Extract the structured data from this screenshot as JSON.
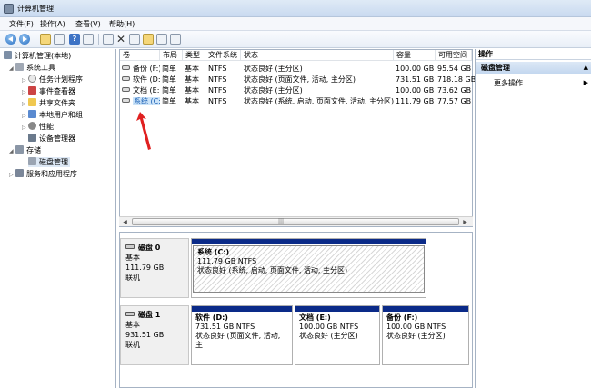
{
  "window": {
    "title": "计算机管理"
  },
  "menu": [
    "文件(F)",
    "操作(A)",
    "查看(V)",
    "帮助(H)"
  ],
  "tree": {
    "root": "计算机管理(本地)",
    "system_tools": "系统工具",
    "task_scheduler": "任务计划程序",
    "event_viewer": "事件查看器",
    "shared_folders": "共享文件夹",
    "local_users": "本地用户和组",
    "performance": "性能",
    "device_manager": "设备管理器",
    "storage": "存储",
    "disk_management": "磁盘管理",
    "services_apps": "服务和应用程序"
  },
  "columns": [
    "卷",
    "布局",
    "类型",
    "文件系统",
    "状态",
    "容量",
    "可用空间"
  ],
  "volumes": [
    {
      "name": "备份 (F:)",
      "layout": "简单",
      "type": "基本",
      "fs": "NTFS",
      "status": "状态良好 (主分区)",
      "capacity": "100.00 GB",
      "free": "95.54 GB"
    },
    {
      "name": "软件 (D:)",
      "layout": "简单",
      "type": "基本",
      "fs": "NTFS",
      "status": "状态良好 (页面文件, 活动, 主分区)",
      "capacity": "731.51 GB",
      "free": "718.18 GB"
    },
    {
      "name": "文档 (E:)",
      "layout": "简单",
      "type": "基本",
      "fs": "NTFS",
      "status": "状态良好 (主分区)",
      "capacity": "100.00 GB",
      "free": "73.62 GB"
    },
    {
      "name": "系统 (C:)",
      "layout": "简单",
      "type": "基本",
      "fs": "NTFS",
      "status": "状态良好 (系统, 启动, 页面文件, 活动, 主分区)",
      "capacity": "111.79 GB",
      "free": "77.57 GB"
    }
  ],
  "disks": [
    {
      "title": "磁盘 0",
      "type": "基本",
      "size": "111.79 GB",
      "state": "联机",
      "partitions": [
        {
          "name": "系统 (C:)",
          "size": "111.79 GB NTFS",
          "status": "状态良好 (系统, 启动, 页面文件, 活动, 主分区)"
        }
      ]
    },
    {
      "title": "磁盘 1",
      "type": "基本",
      "size": "931.51 GB",
      "state": "联机",
      "partitions": [
        {
          "name": "软件 (D:)",
          "size": "731.51 GB NTFS",
          "status": "状态良好 (页面文件, 活动, 主"
        },
        {
          "name": "文档 (E:)",
          "size": "100.00 GB NTFS",
          "status": "状态良好 (主分区)"
        },
        {
          "name": "备份 (F:)",
          "size": "100.00 GB NTFS",
          "status": "状态良好 (主分区)"
        }
      ]
    }
  ],
  "actions": {
    "header": "操作",
    "section": "磁盘管理",
    "more": "更多操作"
  },
  "colors": {
    "partition_bar": "#0a2a88",
    "selection": "#cce4f9",
    "annotation_arrow": "#e02020"
  }
}
